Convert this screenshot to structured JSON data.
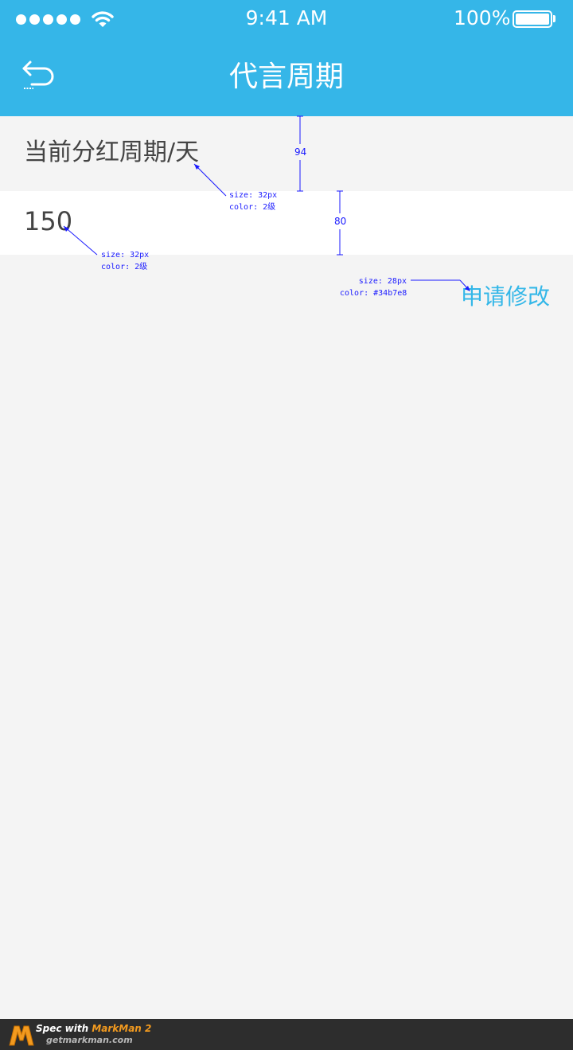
{
  "status_bar": {
    "signal": "●●●●●",
    "time": "9:41 AM",
    "battery_text": "100%"
  },
  "header": {
    "title": "代言周期",
    "background": "#35b6e8"
  },
  "icons": {
    "back": "back-arrow-icon",
    "wifi": "wifi-icon",
    "battery": "battery-icon"
  },
  "cycle": {
    "label": "当前分红周期/天",
    "value": "150"
  },
  "action": {
    "apply_label": "申请修改",
    "color": "#34b7e8"
  },
  "annotations": {
    "label_spec": "size: 32px\ncolor: 2级",
    "value_spec": "size: 32px\ncolor: 2级",
    "apply_spec": "size: 28px\ncolor: #34b7e8",
    "gap_94": "94",
    "gap_80": "80"
  },
  "footer": {
    "spec_with": "Spec with ",
    "brand": "MarkMan 2",
    "url": "getmarkman.com"
  }
}
